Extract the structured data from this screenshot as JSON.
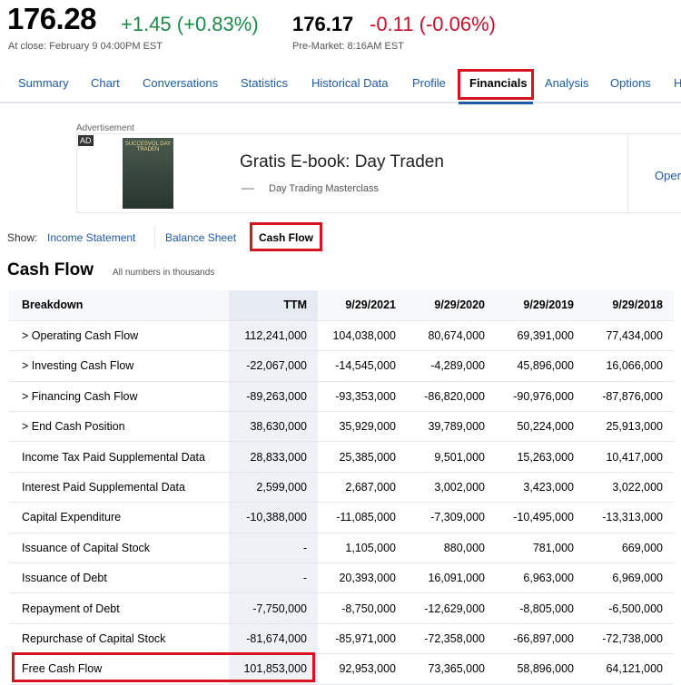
{
  "quote": {
    "price": "176.28",
    "change": "+1.45 (+0.83%)",
    "close_label": "At close: February 9 04:00PM EST",
    "pre_price": "176.17",
    "pre_change": "-0.11 (-0.06%)",
    "pre_label": "Pre-Market: 8:16AM EST"
  },
  "nav": [
    "Summary",
    "Chart",
    "Conversations",
    "Statistics",
    "Historical Data",
    "Profile",
    "Financials",
    "Analysis",
    "Options",
    "H"
  ],
  "ad": {
    "label": "Advertisement",
    "badge": "AD",
    "title": "Gratis E-book: Day Traden",
    "sponsor": "Day Trading Masterclass",
    "cta": "Oper",
    "book_text": "SUCCESVOL DAY TRADEN"
  },
  "show": {
    "label": "Show:",
    "options": [
      "Income Statement",
      "Balance Sheet",
      "Cash Flow"
    ]
  },
  "section": {
    "title": "Cash Flow",
    "note": "All numbers in thousands"
  },
  "table": {
    "headers": [
      "Breakdown",
      "TTM",
      "9/29/2021",
      "9/29/2020",
      "9/29/2019",
      "9/29/2018"
    ],
    "rows": [
      [
        "> Operating Cash Flow",
        "112,241,000",
        "104,038,000",
        "80,674,000",
        "69,391,000",
        "77,434,000"
      ],
      [
        "> Investing Cash Flow",
        "-22,067,000",
        "-14,545,000",
        "-4,289,000",
        "45,896,000",
        "16,066,000"
      ],
      [
        "> Financing Cash Flow",
        "-89,263,000",
        "-93,353,000",
        "-86,820,000",
        "-90,976,000",
        "-87,876,000"
      ],
      [
        "> End Cash Position",
        "38,630,000",
        "35,929,000",
        "39,789,000",
        "50,224,000",
        "25,913,000"
      ],
      [
        "Income Tax Paid Supplemental Data",
        "28,833,000",
        "25,385,000",
        "9,501,000",
        "15,263,000",
        "10,417,000"
      ],
      [
        "Interest Paid Supplemental Data",
        "2,599,000",
        "2,687,000",
        "3,002,000",
        "3,423,000",
        "3,022,000"
      ],
      [
        "Capital Expenditure",
        "-10,388,000",
        "-11,085,000",
        "-7,309,000",
        "-10,495,000",
        "-13,313,000"
      ],
      [
        "Issuance of Capital Stock",
        "-",
        "1,105,000",
        "880,000",
        "781,000",
        "669,000"
      ],
      [
        "Issuance of Debt",
        "-",
        "20,393,000",
        "16,091,000",
        "6,963,000",
        "6,969,000"
      ],
      [
        "Repayment of Debt",
        "-7,750,000",
        "-8,750,000",
        "-12,629,000",
        "-8,805,000",
        "-6,500,000"
      ],
      [
        "Repurchase of Capital Stock",
        "-81,674,000",
        "-85,971,000",
        "-72,358,000",
        "-66,897,000",
        "-72,738,000"
      ],
      [
        "Free Cash Flow",
        "101,853,000",
        "92,953,000",
        "73,365,000",
        "58,896,000",
        "64,121,000"
      ]
    ]
  }
}
